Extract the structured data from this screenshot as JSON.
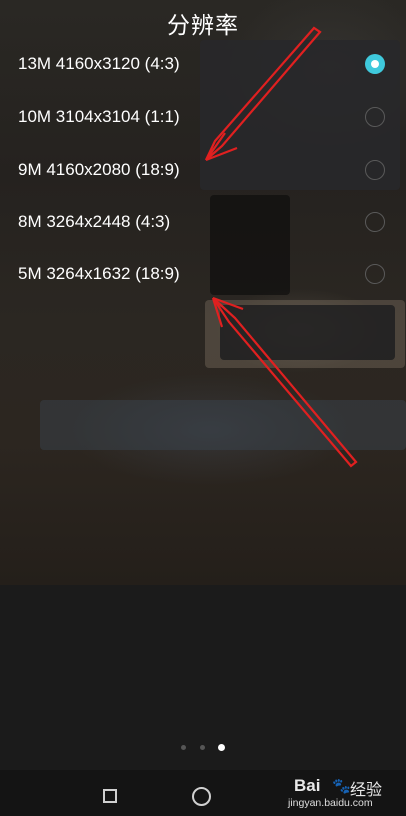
{
  "header": {
    "title": "分辨率"
  },
  "resolution_options": [
    {
      "label": "13M 4160x3120 (4:3)",
      "selected": true
    },
    {
      "label": "10M 3104x3104 (1:1)",
      "selected": false
    },
    {
      "label": "9M 4160x2080 (18:9)",
      "selected": false
    },
    {
      "label": "8M 3264x2448 (4:3)",
      "selected": false
    },
    {
      "label": "5M 3264x1632 (18:9)",
      "selected": false
    }
  ],
  "colors": {
    "accent": "#3fc9dc",
    "annotation_arrow": "#e02020",
    "text": "#ffffff"
  },
  "pager": {
    "page_count": 3,
    "active_page": 3
  },
  "navbar": {
    "icons": [
      "recent-apps-icon",
      "home-icon"
    ]
  },
  "watermark": {
    "logo": "Bai",
    "logo_suffix": "经验",
    "url": "jingyan.baidu.com"
  }
}
